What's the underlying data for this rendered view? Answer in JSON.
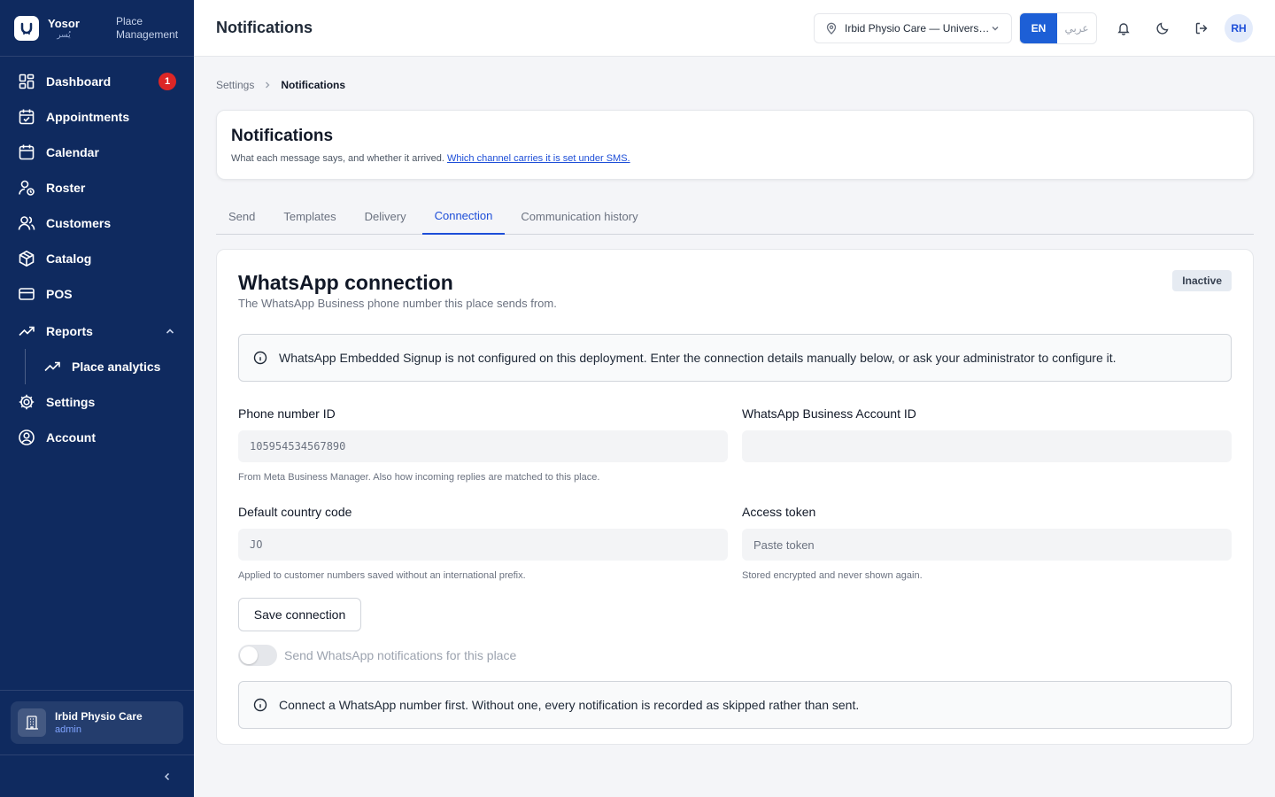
{
  "brand": {
    "name": "Yosor",
    "name_ar": "يُسر",
    "subtitle": "Place Management"
  },
  "sidebar": {
    "items": [
      {
        "label": "Dashboard",
        "icon": "grid-icon",
        "badge": "1"
      },
      {
        "label": "Appointments",
        "icon": "calendar-check-icon"
      },
      {
        "label": "Calendar",
        "icon": "calendar-icon"
      },
      {
        "label": "Roster",
        "icon": "user-clock-icon"
      },
      {
        "label": "Customers",
        "icon": "users-icon"
      },
      {
        "label": "Catalog",
        "icon": "box-icon"
      },
      {
        "label": "POS",
        "icon": "credit-card-icon"
      },
      {
        "label": "Reports",
        "icon": "trending-up-icon",
        "expanded": true
      },
      {
        "label": "Place analytics",
        "icon": "trending-up-icon",
        "sub": true
      },
      {
        "label": "Settings",
        "icon": "gear-icon"
      },
      {
        "label": "Account",
        "icon": "user-circle-icon"
      }
    ],
    "footer": {
      "place_name": "Irbid Physio Care",
      "role": "admin"
    }
  },
  "topbar": {
    "title": "Notifications",
    "place_select": "Irbid Physio Care — University Street",
    "lang_en": "EN",
    "lang_ar": "عربي",
    "avatar": "RH"
  },
  "breadcrumb": {
    "parent": "Settings",
    "current": "Notifications"
  },
  "hero": {
    "title": "Notifications",
    "description": "What each message says, and whether it arrived.",
    "link": "Which channel carries it is set under SMS."
  },
  "tabs": [
    {
      "label": "Send",
      "active": false
    },
    {
      "label": "Templates",
      "active": false
    },
    {
      "label": "Delivery",
      "active": false
    },
    {
      "label": "Connection",
      "active": true
    },
    {
      "label": "Communication history",
      "active": false
    }
  ],
  "connection": {
    "title": "WhatsApp connection",
    "subtitle": "The WhatsApp Business phone number this place sends from.",
    "status": "Inactive",
    "notice": "WhatsApp Embedded Signup is not configured on this deployment. Enter the connection details manually below, or ask your administrator to configure it.",
    "phone_label": "Phone number ID",
    "phone_placeholder": "105954534567890",
    "phone_hint": "From Meta Business Manager. Also how incoming replies are matched to this place.",
    "waba_label": "WhatsApp Business Account ID",
    "waba_value": "",
    "country_label": "Default country code",
    "country_placeholder": "JO",
    "country_hint": "Applied to customer numbers saved without an international prefix.",
    "token_label": "Access token",
    "token_placeholder": "Paste token",
    "token_hint": "Stored encrypted and never shown again.",
    "save_label": "Save connection",
    "toggle_label": "Send WhatsApp notifications for this place",
    "toggle_on": false,
    "notice2": "Connect a WhatsApp number first. Without one, every notification is recorded as skipped rather than sent."
  },
  "colors": {
    "sidebar": "#0f2a5f",
    "accent": "#1d5fd6",
    "badge": "#dc2626"
  }
}
